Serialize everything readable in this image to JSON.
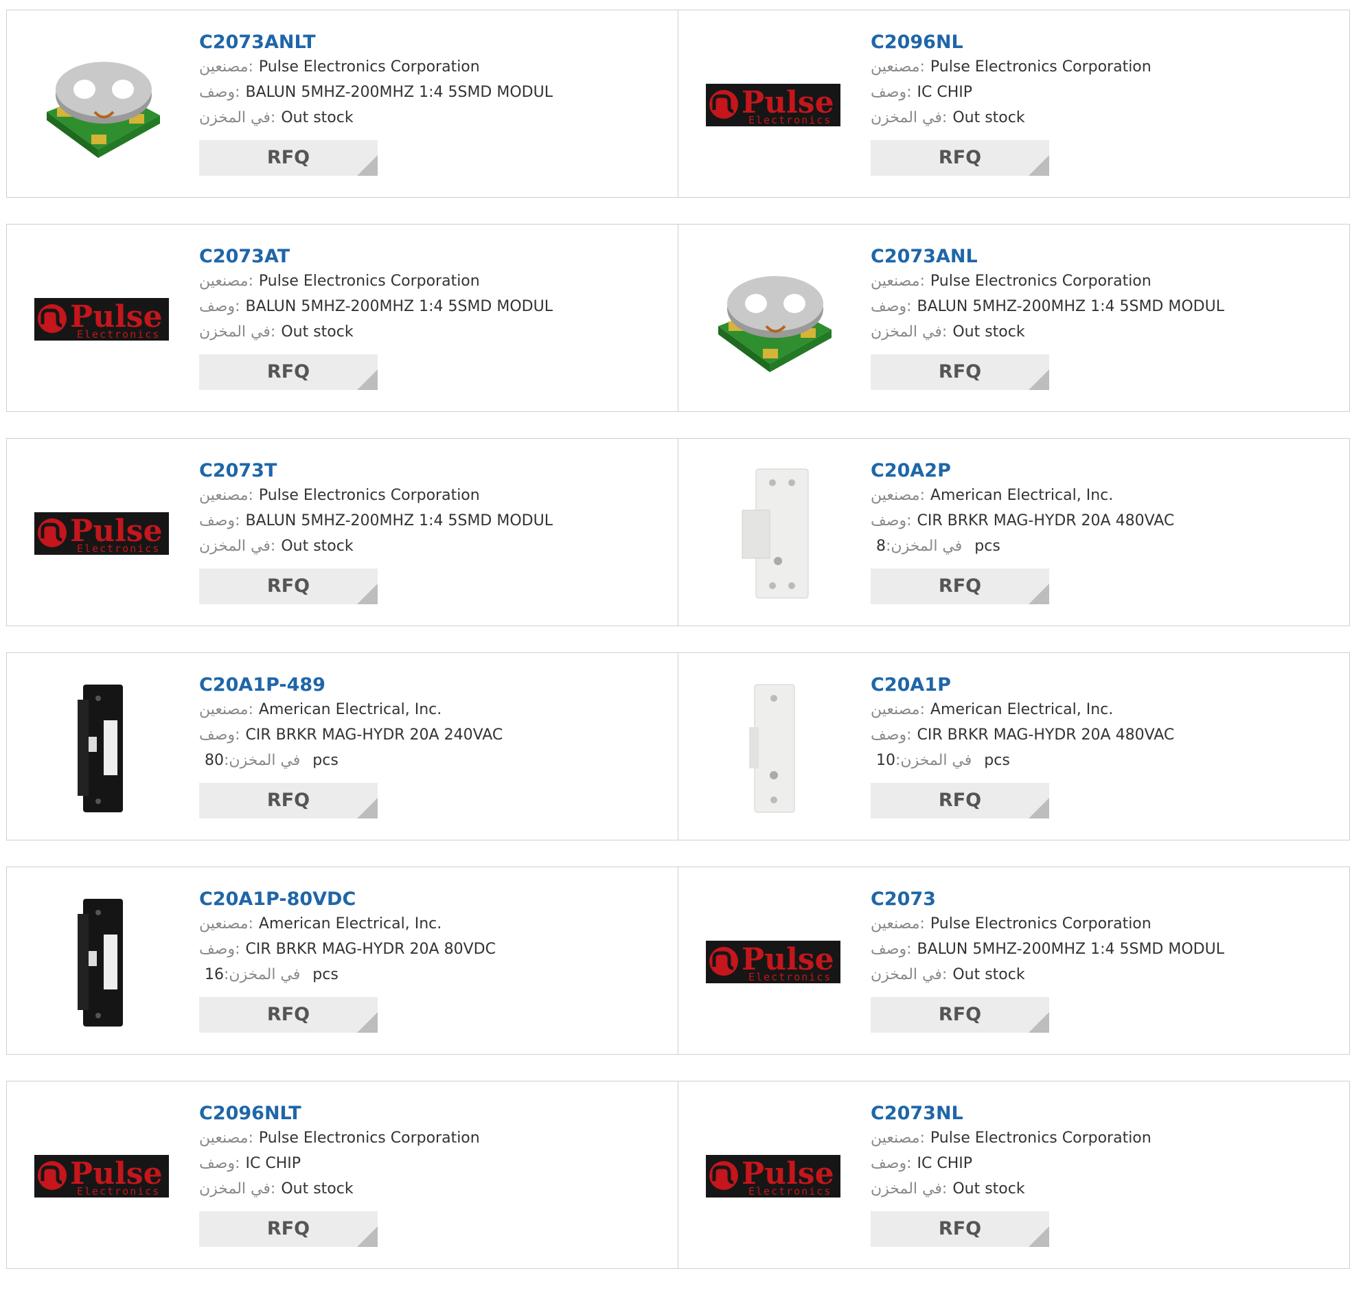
{
  "labels": {
    "manufacturer": "مصنعين:",
    "description": "وصف:",
    "stock": "في المخزن:",
    "rfq": "RFQ",
    "brand": "Pulse",
    "brand_sub": "Electronics"
  },
  "rows": [
    {
      "cells": [
        {
          "part": "C2073ANLT",
          "image": "balun-transformer",
          "manufacturer": "Pulse Electronics Corporation",
          "description": "BALUN 5MHZ-200MHZ 1:4 5SMD MODUL",
          "stock": "Out stock",
          "unit": ""
        },
        {
          "part": "C2096NL",
          "image": "pulse-logo",
          "manufacturer": "Pulse Electronics Corporation",
          "description": "IC CHIP",
          "stock": "Out stock",
          "unit": ""
        }
      ]
    },
    {
      "cells": [
        {
          "part": "C2073AT",
          "image": "pulse-logo",
          "manufacturer": "Pulse Electronics Corporation",
          "description": "BALUN 5MHZ-200MHZ 1:4 5SMD MODUL",
          "stock": "Out stock",
          "unit": ""
        },
        {
          "part": "C2073ANL",
          "image": "balun-transformer",
          "manufacturer": "Pulse Electronics Corporation",
          "description": "BALUN 5MHZ-200MHZ 1:4 5SMD MODUL",
          "stock": "Out stock",
          "unit": ""
        }
      ]
    },
    {
      "cells": [
        {
          "part": "C2073T",
          "image": "pulse-logo",
          "manufacturer": "Pulse Electronics Corporation",
          "description": "BALUN 5MHZ-200MHZ 1:4 5SMD MODUL",
          "stock": "Out stock",
          "unit": ""
        },
        {
          "part": "C20A2P",
          "image": "white-breaker-2pole",
          "manufacturer": "American Electrical, Inc.",
          "description": "CIR BRKR MAG-HYDR 20A 480VAC",
          "stock": "8",
          "unit": "pcs"
        }
      ]
    },
    {
      "cells": [
        {
          "part": "C20A1P-489",
          "image": "black-breaker",
          "manufacturer": "American Electrical, Inc.",
          "description": "CIR BRKR MAG-HYDR 20A 240VAC",
          "stock": "80",
          "unit": "pcs"
        },
        {
          "part": "C20A1P",
          "image": "white-breaker",
          "manufacturer": "American Electrical, Inc.",
          "description": "CIR BRKR MAG-HYDR 20A 480VAC",
          "stock": "10",
          "unit": "pcs"
        }
      ]
    },
    {
      "cells": [
        {
          "part": "C20A1P-80VDC",
          "image": "black-breaker",
          "manufacturer": "American Electrical, Inc.",
          "description": "CIR BRKR MAG-HYDR 20A 80VDC",
          "stock": "16",
          "unit": "pcs"
        },
        {
          "part": "C2073",
          "image": "pulse-logo",
          "manufacturer": "Pulse Electronics Corporation",
          "description": "BALUN 5MHZ-200MHZ 1:4 5SMD MODUL",
          "stock": "Out stock",
          "unit": ""
        }
      ]
    },
    {
      "cells": [
        {
          "part": "C2096NLT",
          "image": "pulse-logo",
          "manufacturer": "Pulse Electronics Corporation",
          "description": "IC CHIP",
          "stock": "Out stock",
          "unit": ""
        },
        {
          "part": "C2073NL",
          "image": "pulse-logo",
          "manufacturer": "Pulse Electronics Corporation",
          "description": "IC CHIP",
          "stock": "Out stock",
          "unit": ""
        }
      ]
    }
  ]
}
